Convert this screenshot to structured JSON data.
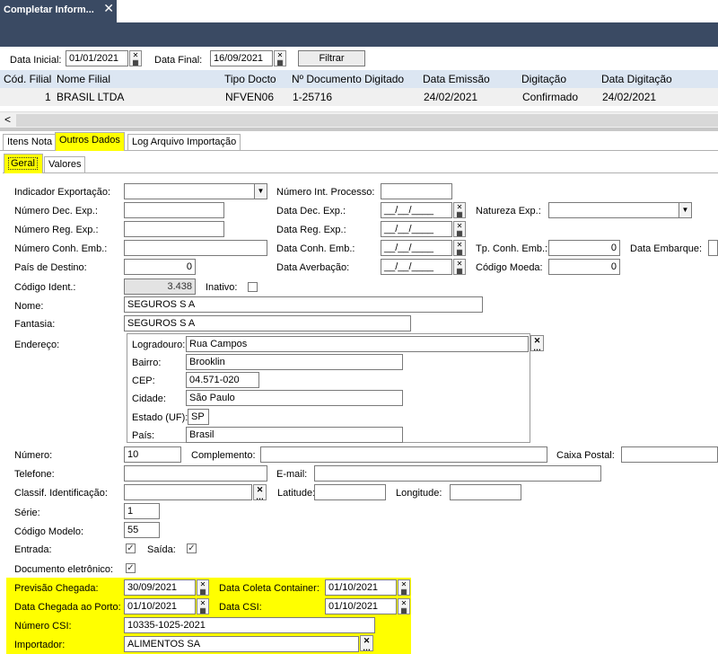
{
  "window": {
    "tab_title": "Completar Inform...",
    "close": "✕"
  },
  "filter": {
    "data_inicial_label": "Data Inicial:",
    "data_inicial": "01/01/2021",
    "data_final_label": "Data Final:",
    "data_final": "16/09/2021",
    "filtrar": "Filtrar"
  },
  "grid": {
    "headers": [
      "Cód. Filial",
      "Nome Filial",
      "Tipo Docto",
      "Nº Documento Digitado",
      "Data Emissão",
      "Digitação",
      "Data Digitação"
    ],
    "row": [
      "1",
      "BRASIL LTDA",
      "NFVEN06",
      "1-25716",
      "24/02/2021",
      "Confirmado",
      "24/02/2021"
    ],
    "scroll_left": "<"
  },
  "tabs": {
    "itens_nota": "Itens Nota",
    "outros_dados": "Outros Dados",
    "log": "Log Arquivo Importação"
  },
  "subtabs": {
    "geral": "Geral",
    "valores": "Valores"
  },
  "form": {
    "indicador_exportacao": "Indicador Exportação:",
    "numero_int_processo": "Número Int. Processo:",
    "numero_dec_exp": "Número Dec. Exp.:",
    "data_dec_exp": "Data Dec. Exp.:",
    "natureza_exp": "Natureza Exp.:",
    "numero_reg_exp": "Número Reg. Exp.:",
    "data_reg_exp": "Data Reg. Exp.:",
    "numero_conh_emb": "Número Conh. Emb.:",
    "data_conh_emb": "Data Conh. Emb.:",
    "tp_conh_emb": "Tp. Conh. Emb.:",
    "tp_conh_emb_value": "0",
    "data_embarque": "Data Embarque:",
    "pais_destino": "País de Destino:",
    "pais_destino_value": "0",
    "data_averbacao": "Data Averbação:",
    "codigo_moeda": "Código Moeda:",
    "codigo_moeda_value": "0",
    "empty_date": "__/__/____",
    "codigo_ident": "Código Ident.:",
    "codigo_ident_value": "3.438",
    "inativo": "Inativo:",
    "nome": "Nome:",
    "nome_value": "SEGUROS S A",
    "fantasia": "Fantasia:",
    "fantasia_value": "SEGUROS S A",
    "endereco": "Endereço:",
    "logradouro": "Logradouro:",
    "logradouro_value": "Rua Campos",
    "bairro": "Bairro:",
    "bairro_value": "Brooklin",
    "cep": "CEP:",
    "cep_value": "04.571-020",
    "cidade": "Cidade:",
    "cidade_value": "São Paulo",
    "estado": "Estado (UF):",
    "estado_value": "SP",
    "pais": "País:",
    "pais_value": "Brasil",
    "numero": "Número:",
    "numero_value": "10",
    "complemento": "Complemento:",
    "caixa_postal": "Caixa Postal:",
    "telefone": "Telefone:",
    "email": "E-mail:",
    "classif": "Classif. Identificação:",
    "latitude": "Latitude:",
    "longitude": "Longitude:",
    "serie": "Série:",
    "serie_value": "1",
    "codigo_modelo": "Código Modelo:",
    "codigo_modelo_value": "55",
    "entrada": "Entrada:",
    "saida": "Saída:",
    "doc_eletronico": "Documento eletrônico:",
    "check_mark": "✓",
    "previsao_chegada": "Previsão Chegada:",
    "previsao_chegada_value": "30/09/2021",
    "data_coleta_container": "Data Coleta Container:",
    "data_coleta_container_value": "01/10/2021",
    "data_chegada_porto": "Data Chegada ao Porto:",
    "data_chegada_porto_value": "01/10/2021",
    "data_csi": "Data CSI:",
    "data_csi_value": "01/10/2021",
    "numero_csi": "Número CSI:",
    "numero_csi_value": "10335-1025-2021",
    "importador": "Importador:",
    "importador_value": "ALIMENTOS SA"
  },
  "icons": {
    "date_button": "x-calendar-icon",
    "search_button": "ellipsis-search-icon",
    "dropdown": "chevron-down-icon"
  },
  "colors": {
    "banner": "#3a4a63",
    "highlight": "#ffff00",
    "grid_header": "#dce6f2"
  }
}
